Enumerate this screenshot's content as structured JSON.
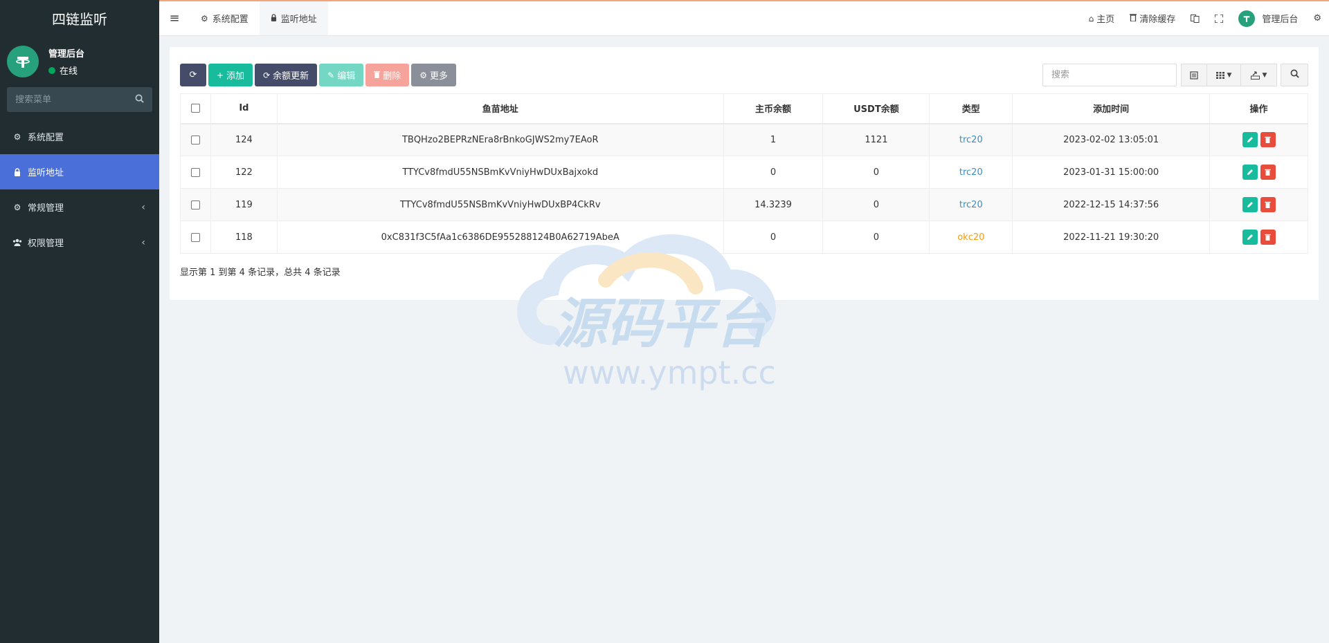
{
  "sidebar": {
    "brand": "四链监听",
    "user": {
      "name": "管理后台",
      "status": "在线"
    },
    "search_placeholder": "搜索菜单",
    "items": [
      {
        "label": "系统配置",
        "icon": "gear-icon",
        "active": false,
        "has_children": false
      },
      {
        "label": "监听地址",
        "icon": "lock-icon",
        "active": true,
        "has_children": false
      },
      {
        "label": "常规管理",
        "icon": "cogs-icon",
        "active": false,
        "has_children": true
      },
      {
        "label": "权限管理",
        "icon": "users-icon",
        "active": false,
        "has_children": true
      }
    ]
  },
  "topbar": {
    "tabs": [
      {
        "label": "系统配置",
        "icon": "gear-icon"
      },
      {
        "label": "监听地址",
        "icon": "lock-icon"
      }
    ],
    "home": "主页",
    "clear_cache": "清除缓存",
    "admin": "管理后台"
  },
  "toolbar": {
    "add": "添加",
    "balance_update": "余额更新",
    "edit": "编辑",
    "delete": "删除",
    "more": "更多",
    "search_placeholder": "搜索"
  },
  "table": {
    "columns": [
      "Id",
      "鱼苗地址",
      "主币余额",
      "USDT余额",
      "类型",
      "添加时间",
      "操作"
    ],
    "rows": [
      {
        "id": "124",
        "address": "TBQHzo2BEPRzNEra8rBnkoGJWS2my7EAoR",
        "main_balance": "1",
        "usdt_balance": "1121",
        "type": "trc20",
        "time": "2023-02-02 13:05:01"
      },
      {
        "id": "122",
        "address": "TTYCv8fmdU55NSBmKvVniyHwDUxBajxokd",
        "main_balance": "0",
        "usdt_balance": "0",
        "type": "trc20",
        "time": "2023-01-31 15:00:00"
      },
      {
        "id": "119",
        "address": "TTYCv8fmdU55NSBmKvVniyHwDUxBP4CkRv",
        "main_balance": "14.3239",
        "usdt_balance": "0",
        "type": "trc20",
        "time": "2022-12-15 14:37:56"
      },
      {
        "id": "118",
        "address": "0xC831f3C5fAa1c6386DE955288124B0A62719AbeA",
        "main_balance": "0",
        "usdt_balance": "0",
        "type": "okc20",
        "time": "2022-11-21 19:30:20"
      }
    ]
  },
  "pagination_info": "显示第 1 到第 4 条记录，总共 4 条记录",
  "watermark": {
    "title": "源码平台",
    "url": "www.ympt.cc"
  },
  "colors": {
    "sidebar_bg": "#222d32",
    "active_menu": "#4a6fd8",
    "success": "#18bc9c",
    "danger": "#e74c3c",
    "trc20": "#3c8dbc",
    "okc20": "#f39c12"
  }
}
